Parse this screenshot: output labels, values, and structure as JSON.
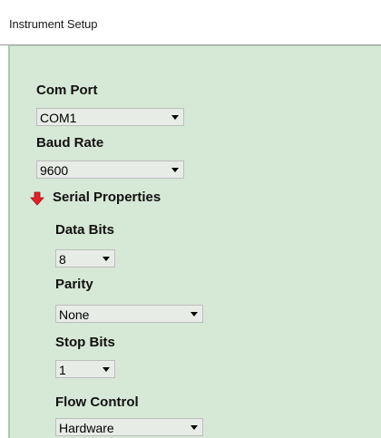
{
  "window": {
    "title": "Instrument Setup"
  },
  "com_port": {
    "label": "Com Port",
    "selected": "COM1"
  },
  "baud_rate": {
    "label": "Baud Rate",
    "selected": "9600"
  },
  "serial_properties": {
    "label": "Serial Properties",
    "expanded": true,
    "icon": "red-down-arrow-icon",
    "icon_color": "#e0202a"
  },
  "data_bits": {
    "label": "Data Bits",
    "selected": "8"
  },
  "parity": {
    "label": "Parity",
    "selected": "None"
  },
  "stop_bits": {
    "label": "Stop Bits",
    "selected": "1"
  },
  "flow_control": {
    "label": "Flow Control",
    "selected": "Hardware"
  },
  "colors": {
    "panel_background": "#d6e8d6",
    "combo_background": "#e7ece7"
  }
}
